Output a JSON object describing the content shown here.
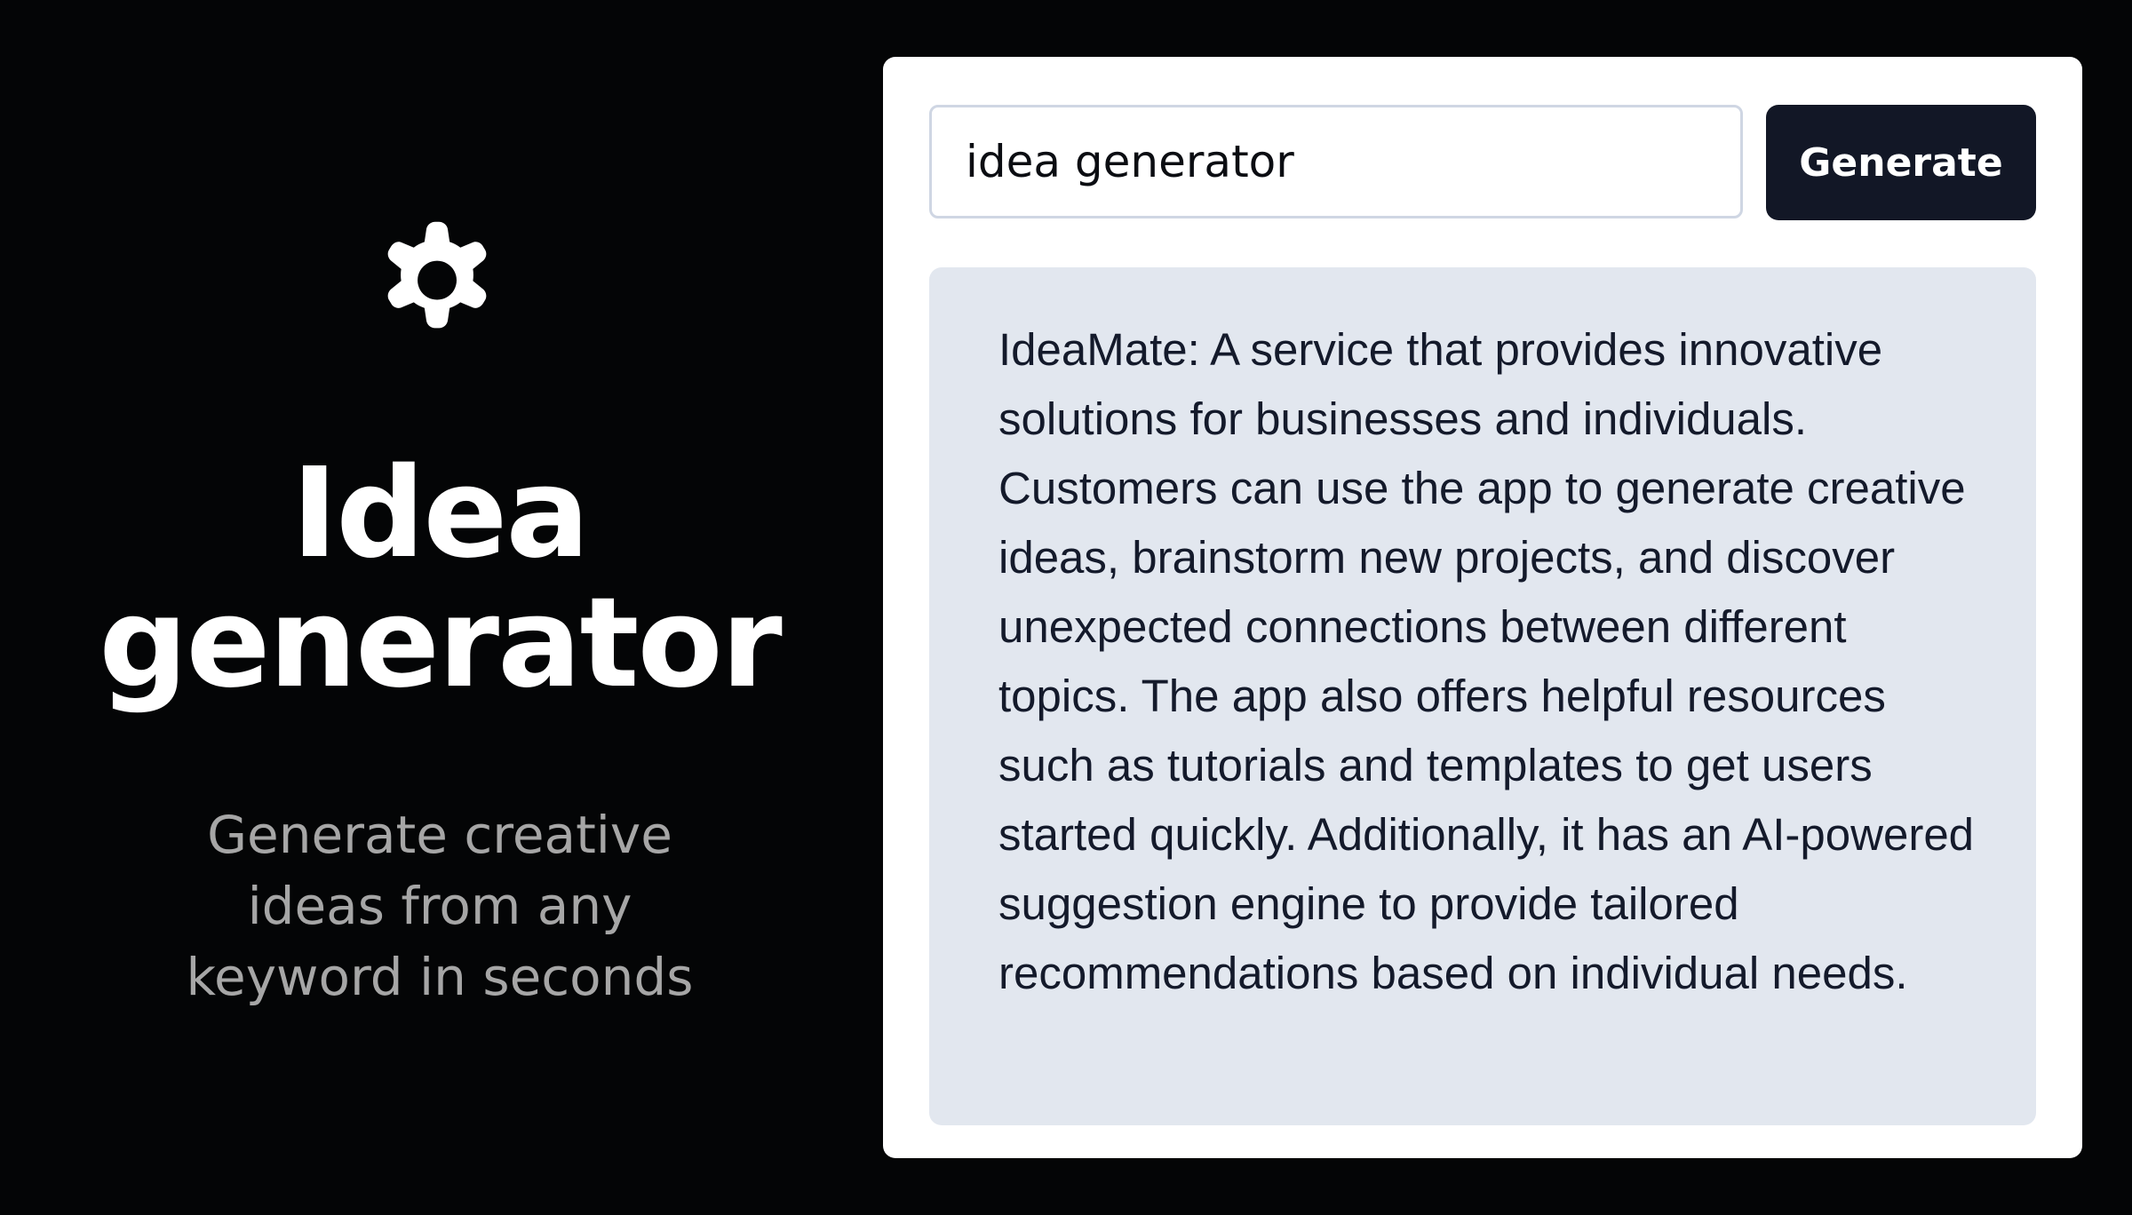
{
  "hero": {
    "icon": "gear-icon",
    "title": "Idea generator",
    "subtitle": "Generate creative ideas from any keyword in seconds"
  },
  "form": {
    "keyword_value": "idea generator",
    "button_label": "Generate"
  },
  "result": {
    "text": "IdeaMate: A service that provides innovative solutions for businesses and individuals. Customers can use the app to generate creative ideas, brainstorm new projects, and discover unexpected connections between different topics. The app also offers helpful resources such as tutorials and templates to get users started quickly. Additionally, it has an AI-powered suggestion engine to provide tailored recommendations based on individual needs."
  },
  "colors": {
    "background": "#040506",
    "card": "#ffffff",
    "button": "#121726",
    "result_background": "#e2e7ef",
    "subtitle": "#a6a6a6"
  }
}
